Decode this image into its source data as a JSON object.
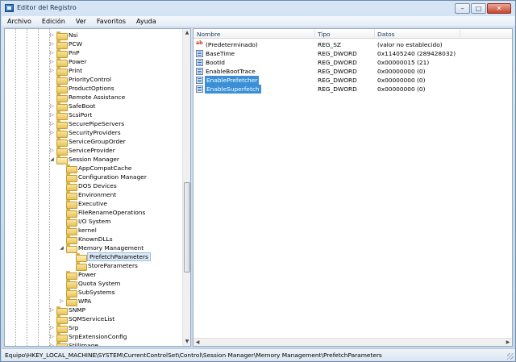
{
  "window": {
    "title": "Editor del Registro",
    "caption_buttons": {
      "minimize": "–",
      "maximize": "□",
      "close": "✕"
    }
  },
  "menu": [
    "Archivo",
    "Edición",
    "Ver",
    "Favoritos",
    "Ayuda"
  ],
  "tree": {
    "items": [
      {
        "label": "Nsi",
        "expander": "▷"
      },
      {
        "label": "PCW",
        "expander": "▷"
      },
      {
        "label": "PnP",
        "expander": "▷"
      },
      {
        "label": "Power",
        "expander": "▷"
      },
      {
        "label": "Print",
        "expander": "▷"
      },
      {
        "label": "PriorityControl",
        "expander": ""
      },
      {
        "label": "ProductOptions",
        "expander": ""
      },
      {
        "label": "Remote Assistance",
        "expander": ""
      },
      {
        "label": "SafeBoot",
        "expander": "▷"
      },
      {
        "label": "ScsiPort",
        "expander": "▷"
      },
      {
        "label": "SecurePipeServers",
        "expander": "▷"
      },
      {
        "label": "SecurityProviders",
        "expander": "▷"
      },
      {
        "label": "ServiceGroupOrder",
        "expander": ""
      },
      {
        "label": "ServiceProvider",
        "expander": "▷"
      },
      {
        "label": "Session Manager",
        "expander": "◢"
      },
      {
        "label": "AppCompatCache",
        "expander": ""
      },
      {
        "label": "Configuration Manager",
        "expander": ""
      },
      {
        "label": "DOS Devices",
        "expander": ""
      },
      {
        "label": "Environment",
        "expander": ""
      },
      {
        "label": "Executive",
        "expander": ""
      },
      {
        "label": "FileRenameOperations",
        "expander": ""
      },
      {
        "label": "I/O System",
        "expander": ""
      },
      {
        "label": "kernel",
        "expander": ""
      },
      {
        "label": "KnownDLLs",
        "expander": ""
      },
      {
        "label": "Memory Management",
        "expander": "◢"
      },
      {
        "label": "PrefetchParameters",
        "expander": "",
        "selected": true
      },
      {
        "label": "StoreParameters",
        "expander": ""
      },
      {
        "label": "Power",
        "expander": ""
      },
      {
        "label": "Quota System",
        "expander": ""
      },
      {
        "label": "SubSystems",
        "expander": ""
      },
      {
        "label": "WPA",
        "expander": "▷"
      },
      {
        "label": "SNMP",
        "expander": "▷"
      },
      {
        "label": "SQMServiceList",
        "expander": ""
      },
      {
        "label": "Srp",
        "expander": "▷"
      },
      {
        "label": "SrpExtensionConfig",
        "expander": "▷"
      },
      {
        "label": "StillImage",
        "expander": "▷"
      }
    ],
    "scroll_arrows": {
      "up": "▲",
      "down": "▼"
    }
  },
  "values_list": {
    "columns": {
      "name": "Nombre",
      "type": "Tipo",
      "data": "Datos"
    },
    "rows": [
      {
        "icon": "string-value-icon",
        "icon_text": "ab",
        "name": "(Predeterminado)",
        "type": "REG_SZ",
        "data": "(valor no establecido)"
      },
      {
        "icon": "binary-value-icon",
        "icon_text": "",
        "name": "BaseTime",
        "type": "REG_DWORD",
        "data": "0x11405240 (289428032)"
      },
      {
        "icon": "binary-value-icon",
        "icon_text": "",
        "name": "BootId",
        "type": "REG_DWORD",
        "data": "0x00000015 (21)"
      },
      {
        "icon": "binary-value-icon",
        "icon_text": "",
        "name": "EnableBootTrace",
        "type": "REG_DWORD",
        "data": "0x00000000 (0)"
      },
      {
        "icon": "binary-value-icon",
        "icon_text": "",
        "name": "EnablePrefetcher",
        "type": "REG_DWORD",
        "data": "0x00000000 (0)",
        "highlighted": true
      },
      {
        "icon": "binary-value-icon",
        "icon_text": "",
        "name": "EnableSuperfetch",
        "type": "REG_DWORD",
        "data": "0x00000000 (0)",
        "highlighted": true
      }
    ],
    "scroll_arrows": {
      "left": "◀",
      "right": "▶"
    }
  },
  "status_bar": {
    "path": "Equipo\\HKEY_LOCAL_MACHINE\\SYSTEM\\CurrentControlSet\\Control\\Session Manager\\Memory Management\\PrefetchParameters"
  }
}
